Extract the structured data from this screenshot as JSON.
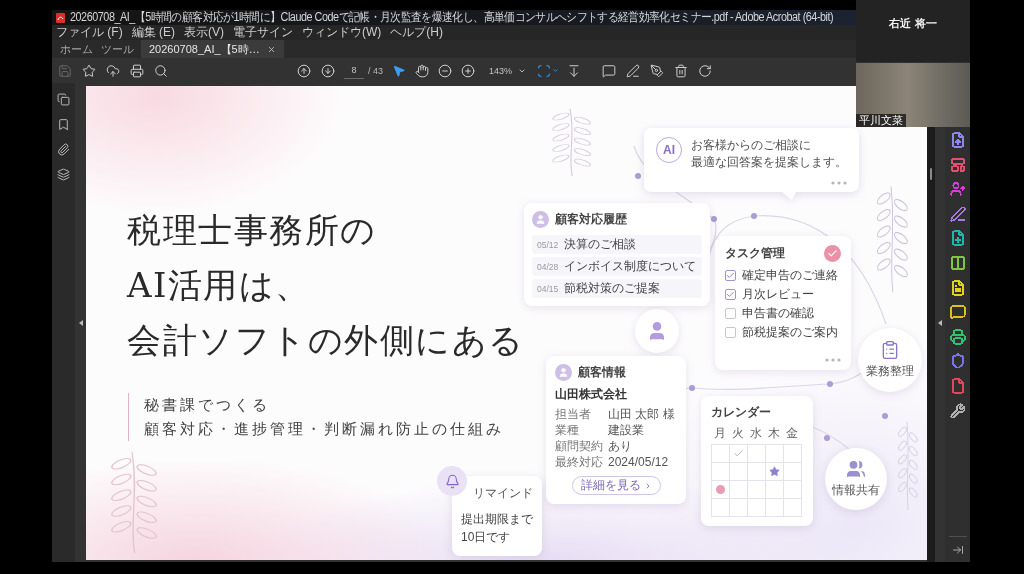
{
  "window": {
    "title": "20260708_AI_【5時間の顧客対応が1時間に】Claude Codeで記帳・月次監査を爆速化し、高単価コンサルへシフトする経営効率化セミナー.pdf - Adobe Acrobat (64-bit)",
    "menu": [
      "ファイル (F)",
      "編集 (E)",
      "表示(V)",
      "電子サイン",
      "ウィンドウ(W)",
      "ヘルプ(H)"
    ]
  },
  "tabs": [
    {
      "label": "ホーム",
      "kind": "nav",
      "selected": false
    },
    {
      "label": "ツール",
      "kind": "nav",
      "selected": false
    },
    {
      "label": "20260708_AI_【5時…",
      "kind": "document",
      "selected": true
    }
  ],
  "toolbar": {
    "file_actions": [
      {
        "kind": "save",
        "disabled": true
      },
      {
        "kind": "favorite",
        "disabled": false
      },
      {
        "kind": "upload",
        "disabled": false
      },
      {
        "kind": "print",
        "disabled": false
      },
      {
        "kind": "search",
        "disabled": false
      }
    ],
    "page_number": "8",
    "page_count": "/ 43",
    "tools": [
      {
        "kind": "select",
        "selected": true
      },
      {
        "kind": "hand",
        "selected": false
      }
    ],
    "zoom": "143%"
  },
  "right_panel": [
    {
      "kind": "export",
      "color": "#8e86f2"
    },
    {
      "kind": "organize",
      "color": "#e0506f"
    },
    {
      "kind": "request_signature",
      "color": "#d63fd6"
    },
    {
      "kind": "fill_sign",
      "color": "#a77be6"
    },
    {
      "kind": "create",
      "color": "#1fb6b0"
    },
    {
      "kind": "combine",
      "color": "#7ec63e"
    },
    {
      "kind": "edit",
      "color": "#e3d21e"
    },
    {
      "kind": "comment",
      "color": "#d9c21a"
    },
    {
      "kind": "print_production",
      "color": "#2fc46a"
    },
    {
      "kind": "protect",
      "color": "#7a72e6"
    },
    {
      "kind": "export_pdf",
      "color": "#e2485a"
    },
    {
      "kind": "more_tools",
      "color": "#b0b0b0"
    }
  ],
  "participants": [
    {
      "name": "右近 将一",
      "kind": "audio"
    },
    {
      "name": "平川文菜",
      "kind": "video"
    }
  ],
  "slide": {
    "title_lines": [
      "税理士事務所の",
      "AI活用は、",
      "会計ソフトの外側にある"
    ],
    "subtitle_lines": [
      "秘書課でつくる",
      "顧客対応・進捗管理・判断漏れ防止の仕組み"
    ],
    "ai_message": {
      "badge": "AI",
      "lines": [
        "お客様からのご相談に",
        "最適な回答案を提案します。"
      ]
    },
    "history": {
      "title": "顧客対応履歴",
      "rows": [
        {
          "date": "05/12",
          "text": "決算のご相談"
        },
        {
          "date": "04/28",
          "text": "インボイス制度について"
        },
        {
          "date": "04/15",
          "text": "節税対策のご提案"
        }
      ]
    },
    "tasks": {
      "title": "タスク管理",
      "items": [
        {
          "label": "確定申告のご連絡",
          "checked": true
        },
        {
          "label": "月次レビュー",
          "checked": true
        },
        {
          "label": "申告書の確認",
          "checked": false
        },
        {
          "label": "節税提案のご案内",
          "checked": false
        }
      ]
    },
    "business_node": {
      "label": "業務整理"
    },
    "client": {
      "title": "顧客情報",
      "company": "山田株式会社",
      "fields": [
        {
          "label": "担当者",
          "value": "山田 太郎 様"
        },
        {
          "label": "業種",
          "value": "建設業"
        },
        {
          "label": "顧問契約",
          "value": "あり"
        },
        {
          "label": "最終対応",
          "value": "2024/05/12"
        }
      ],
      "button": "詳細を見る"
    },
    "calendar": {
      "title": "カレンダー",
      "weekdays": [
        "月",
        "火",
        "水",
        "木",
        "金"
      ],
      "weeks": [
        {
          "days": [
            {
              "kind": "empty"
            },
            {
              "kind": "check"
            },
            {
              "kind": "empty"
            },
            {
              "kind": "empty"
            },
            {
              "kind": "empty"
            }
          ]
        },
        {
          "days": [
            {
              "kind": "empty"
            },
            {
              "kind": "empty"
            },
            {
              "kind": "empty"
            },
            {
              "kind": "star"
            },
            {
              "kind": "empty"
            }
          ]
        },
        {
          "days": [
            {
              "kind": "dot"
            },
            {
              "kind": "empty"
            },
            {
              "kind": "empty"
            },
            {
              "kind": "empty"
            },
            {
              "kind": "empty"
            }
          ]
        },
        {
          "days": [
            {
              "kind": "empty"
            },
            {
              "kind": "empty"
            },
            {
              "kind": "empty"
            },
            {
              "kind": "empty"
            },
            {
              "kind": "empty"
            }
          ]
        }
      ]
    },
    "sharing_node": {
      "label": "情報共有"
    },
    "reminder": {
      "title": "リマインド",
      "lines": [
        "提出期限まで",
        "10日です"
      ]
    }
  }
}
